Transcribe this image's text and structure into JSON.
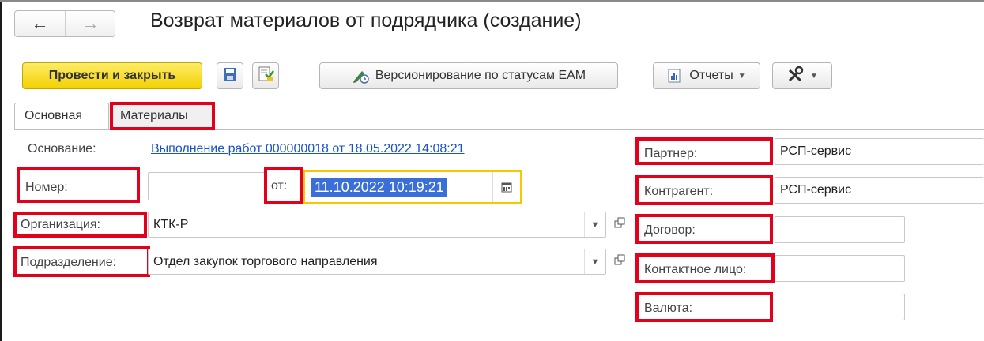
{
  "window": {
    "title": "Возврат материалов от подрядчика (создание)",
    "nav_back_icon": "arrow-left-icon",
    "nav_forward_icon": "arrow-right-icon"
  },
  "toolbar": {
    "post_and_close": "Провести и закрыть",
    "save_icon": "floppy-disk-icon",
    "post_icon": "document-post-icon",
    "versioning": "Версионирование по статусам ЕАМ",
    "reports": "Отчеты",
    "tools_icon": "tools-icon",
    "accent_color": "#f5d300"
  },
  "tabs": [
    {
      "label": "Основная",
      "active": true
    },
    {
      "label": "Материалы",
      "active": false
    }
  ],
  "form": {
    "basis": {
      "label": "Основание:",
      "value": "Выполнение работ 000000018 от 18.05.2022 14:08:21"
    },
    "number": {
      "label": "Номер:",
      "value": ""
    },
    "date": {
      "label": "от:",
      "value": "11.10.2022 10:19:21"
    },
    "organization": {
      "label": "Организация:",
      "value": "КТК-Р"
    },
    "department": {
      "label": "Подразделение:",
      "value": "Отдел закупок торгового направления"
    },
    "partner": {
      "label": "Партнер:",
      "value": "РСП-сервис"
    },
    "counterparty": {
      "label": "Контрагент:",
      "value": "РСП-сервис"
    },
    "contract": {
      "label": "Договор:",
      "value": ""
    },
    "contact_person": {
      "label": "Контактное лицо:",
      "value": ""
    },
    "currency": {
      "label": "Валюта:",
      "value": ""
    }
  },
  "highlight_color": "#e3001b"
}
